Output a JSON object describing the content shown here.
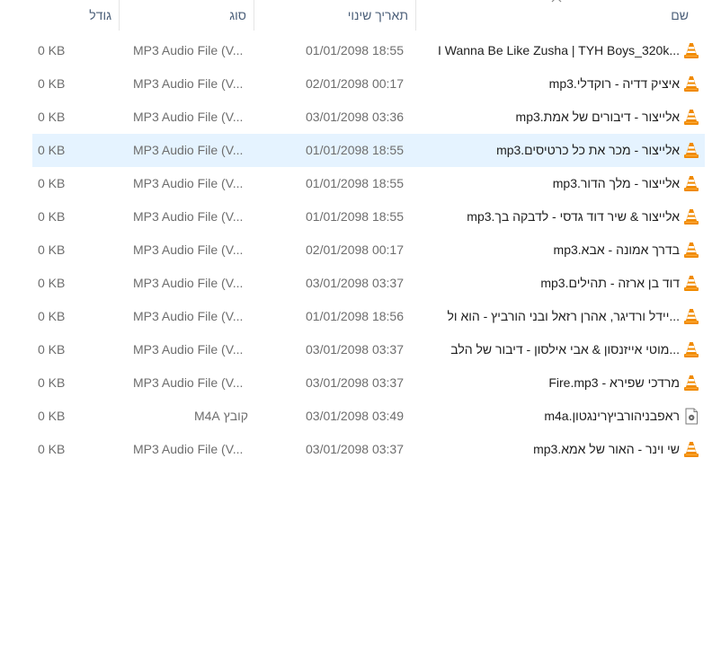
{
  "columns": {
    "name": "שם",
    "date": "תאריך שינוי",
    "type": "סוג",
    "size": "גודל"
  },
  "icons": {
    "mp3": "vlc-cone-icon",
    "m4a": "audio-file-icon",
    "sort": "sort-up-chevron-icon"
  },
  "colors": {
    "selected_row": "#e5f3ff",
    "header_text": "#4c607a",
    "muted_text": "#6d6d6d",
    "vlc_orange": "#f08a00"
  },
  "files": [
    {
      "name": "...I Wanna Be Like Zusha  |  TYH Boys_320k",
      "date": "01/01/2098 18:55",
      "type": "MP3 Audio File (V...",
      "size": "0 KB",
      "icon": "mp3",
      "selected": false
    },
    {
      "name": "איציק דדיה - רוקדלי.mp3",
      "date": "02/01/2098 00:17",
      "type": "MP3 Audio File (V...",
      "size": "0 KB",
      "icon": "mp3",
      "selected": false
    },
    {
      "name": "אלייצור - דיבורים של אמת.mp3",
      "date": "03/01/2098 03:36",
      "type": "MP3 Audio File (V...",
      "size": "0 KB",
      "icon": "mp3",
      "selected": false
    },
    {
      "name": "אלייצור - מכר את כל כרטיסים.mp3",
      "date": "01/01/2098 18:55",
      "type": "MP3 Audio File (V...",
      "size": "0 KB",
      "icon": "mp3",
      "selected": true
    },
    {
      "name": "אלייצור - מלך הדור.mp3",
      "date": "01/01/2098 18:55",
      "type": "MP3 Audio File (V...",
      "size": "0 KB",
      "icon": "mp3",
      "selected": false
    },
    {
      "name": "אלייצור & שיר דוד גדסי - לדבקה בך.mp3",
      "date": "01/01/2098 18:55",
      "type": "MP3 Audio File (V...",
      "size": "0 KB",
      "icon": "mp3",
      "selected": false
    },
    {
      "name": "בדרך אמונה - אבא.mp3",
      "date": "02/01/2098 00:17",
      "type": "MP3 Audio File (V...",
      "size": "0 KB",
      "icon": "mp3",
      "selected": false
    },
    {
      "name": "דוד בן ארזה - תהילים.mp3",
      "date": "03/01/2098 03:37",
      "type": "MP3 Audio File (V...",
      "size": "0 KB",
      "icon": "mp3",
      "selected": false
    },
    {
      "name": "...יידל ורדיגר, אהרן רזאל ובני הורביץ - הוא ול",
      "date": "01/01/2098 18:56",
      "type": "MP3 Audio File (V...",
      "size": "0 KB",
      "icon": "mp3",
      "selected": false
    },
    {
      "name": "...מוטי אייזנסון & אבי אילסון - דיבור של הלב",
      "date": "03/01/2098 03:37",
      "type": "MP3 Audio File (V...",
      "size": "0 KB",
      "icon": "mp3",
      "selected": false
    },
    {
      "name": "מרדכי שפירא - Fire.mp3",
      "date": "03/01/2098 03:37",
      "type": "MP3 Audio File (V...",
      "size": "0 KB",
      "icon": "mp3",
      "selected": false
    },
    {
      "name": "ראפבניהורביץרינגטון.m4a",
      "date": "03/01/2098 03:49",
      "type": "קובץ M4A",
      "size": "0 KB",
      "icon": "m4a",
      "selected": false
    },
    {
      "name": "שי וינר - האור של אמא.mp3",
      "date": "03/01/2098 03:37",
      "type": "MP3 Audio File (V...",
      "size": "0 KB",
      "icon": "mp3",
      "selected": false
    }
  ]
}
